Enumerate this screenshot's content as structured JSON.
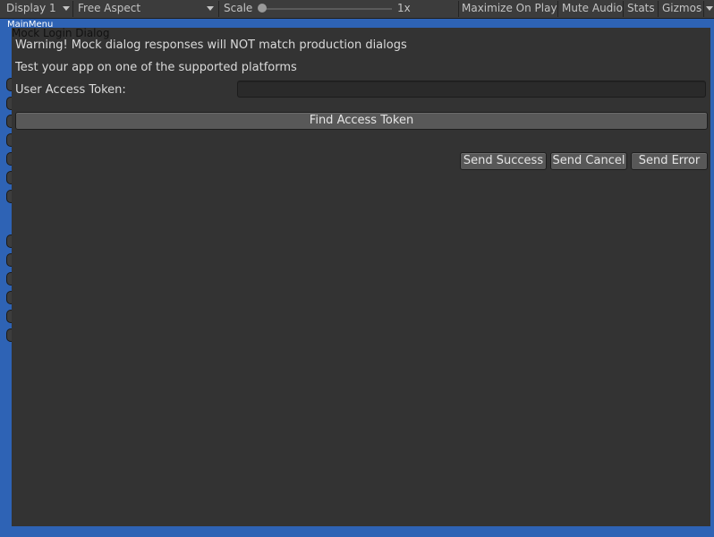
{
  "toolbar": {
    "display": "Display 1",
    "aspect": "Free Aspect",
    "scale_label": "Scale",
    "scale_value": "1x",
    "maximize": "Maximize On Play",
    "mute": "Mute Audio",
    "stats": "Stats",
    "gizmos": "Gizmos"
  },
  "background": {
    "menu_label": "MainMenu"
  },
  "dialog": {
    "title": "Mock Login Dialog",
    "warning": "Warning! Mock dialog responses will NOT match production dialogs",
    "hint": "Test your app on one of the supported platforms",
    "token_label": "User Access Token:",
    "token_value": "",
    "find_button": "Find Access Token",
    "success_button": "Send Success",
    "cancel_button": "Send Cancel",
    "error_button": "Send Error"
  },
  "colors": {
    "background_blue": "#2e63b5",
    "dialog_bg": "#333333",
    "toolbar_bg": "#3c3c3c",
    "button_bg": "#585858"
  }
}
